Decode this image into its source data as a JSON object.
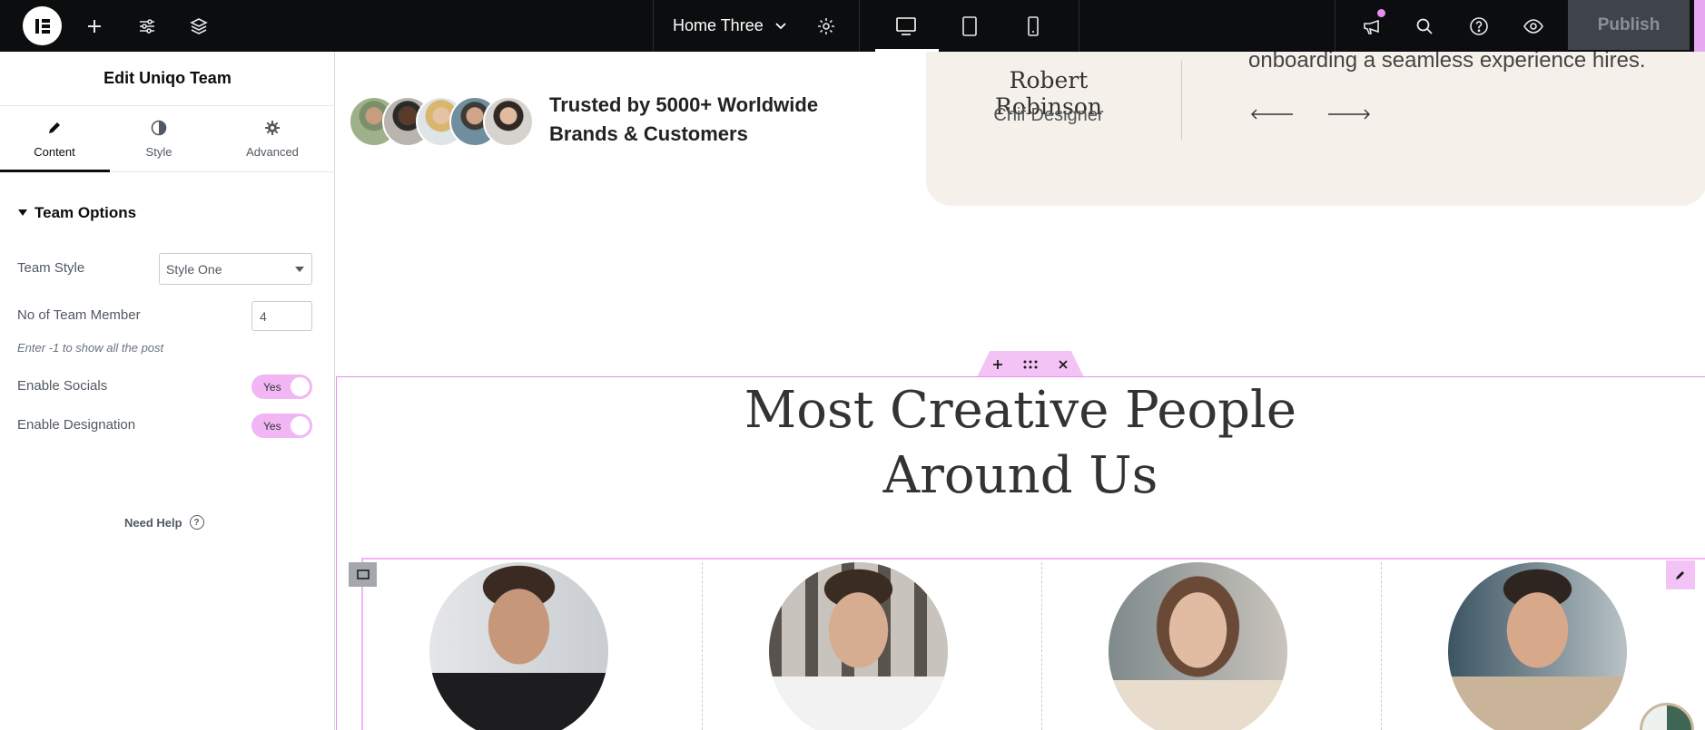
{
  "topbar": {
    "page_name": "Home Three",
    "publish_label": "Publish",
    "icons": [
      "elementor-logo-icon",
      "add-icon",
      "sliders-icon",
      "layers-icon",
      "chevron-down-icon",
      "gear-icon",
      "desktop-icon",
      "tablet-icon",
      "mobile-icon",
      "megaphone-icon",
      "search-icon",
      "help-icon",
      "eye-icon"
    ],
    "colors": {
      "bar": "#0c0d0e",
      "publish_bg": "#3f444b",
      "accent": "#e48ff0"
    }
  },
  "panel": {
    "title": "Edit Uniqo Team",
    "tabs": [
      {
        "label": "Content",
        "icon": "pencil-icon"
      },
      {
        "label": "Style",
        "icon": "contrast-icon"
      },
      {
        "label": "Advanced",
        "icon": "gear-icon"
      }
    ],
    "section_title": "Team Options",
    "team_style": {
      "label": "Team Style",
      "value": "Style One"
    },
    "team_members": {
      "label": "No of Team Member",
      "value": "4",
      "hint": "Enter -1 to show all the post"
    },
    "enable_socials": {
      "label": "Enable Socials",
      "value": "Yes"
    },
    "enable_designation": {
      "label": "Enable Designation",
      "value": "Yes"
    },
    "need_help": "Need Help"
  },
  "canvas": {
    "trusted_line1": "Trusted by 5000+ Worldwide",
    "trusted_line2": "Brands & Customers",
    "testimonial": {
      "name": "Robert Robinson",
      "role": "Chif Designer",
      "text": "onboarding a seamless experience hires."
    },
    "heading_line1": "Most Creative People",
    "heading_line2": "Around Us",
    "colors": {
      "card_bg": "#f5f1ea",
      "outline": "#e48ff0"
    }
  }
}
